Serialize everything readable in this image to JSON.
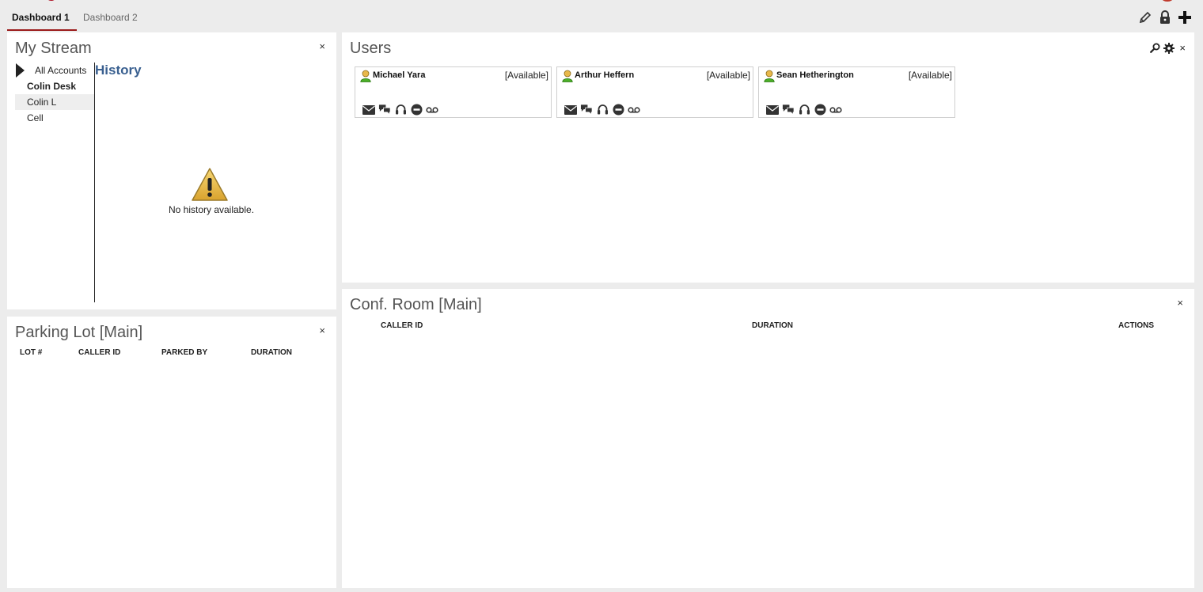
{
  "tabs": [
    {
      "label": "Dashboard 1",
      "active": true
    },
    {
      "label": "Dashboard 2",
      "active": false
    }
  ],
  "toolbar_icons": [
    "pencil-icon",
    "lock-icon",
    "plus-icon"
  ],
  "stream": {
    "title": "My Stream",
    "close": "×",
    "accounts": [
      "All Accounts",
      "Colin Desk",
      "Colin L",
      "Cell"
    ],
    "history_title": "History",
    "empty_message": "No history available."
  },
  "parking": {
    "title": "Parking Lot [Main]",
    "close": "×",
    "columns": [
      "LOT #",
      "CALLER ID",
      "PARKED BY",
      "DURATION"
    ]
  },
  "users": {
    "title": "Users",
    "close": "×",
    "list": [
      {
        "name": "Michael Yara",
        "status": "[Available]"
      },
      {
        "name": "Arthur Heffern",
        "status": "[Available]"
      },
      {
        "name": "Sean Hetherington",
        "status": "[Available]"
      }
    ],
    "action_icons": [
      "email-icon",
      "chat-icon",
      "headset-icon",
      "do-not-disturb-icon",
      "voicemail-icon"
    ]
  },
  "conf": {
    "title": "Conf. Room [Main]",
    "close": "×",
    "columns": [
      "CALLER ID",
      "DURATION",
      "ACTIONS"
    ]
  },
  "colors": {
    "brand": "#9b1b1b",
    "history_link": "#3a6090",
    "presence": "#4caf28"
  }
}
